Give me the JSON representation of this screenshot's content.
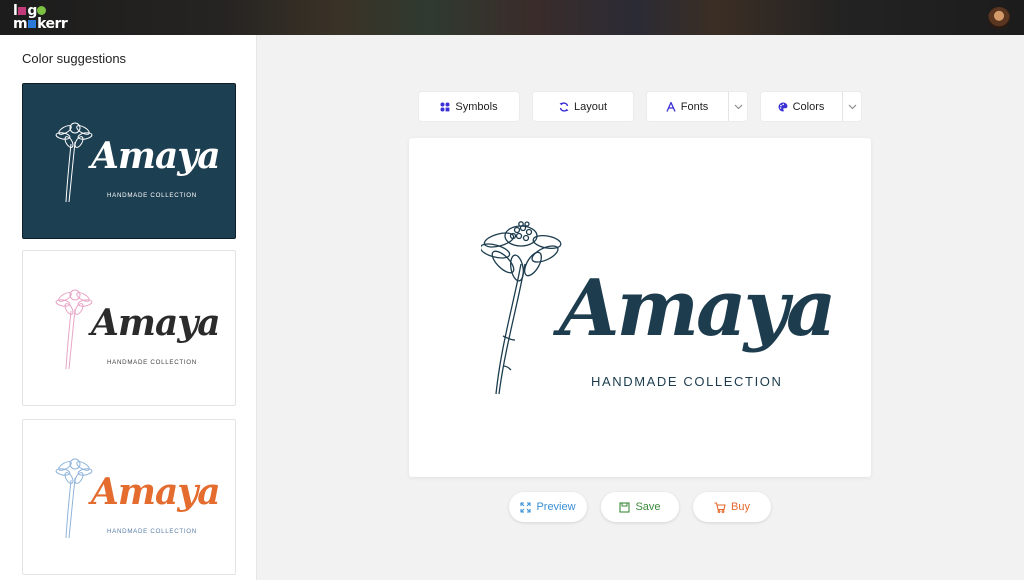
{
  "app": {
    "logo_line1": "lgo",
    "logo_line2": "mkerr",
    "logo_colors": {
      "dot": "#7cc142",
      "square": "#c23a7a"
    }
  },
  "user": {
    "avatar_icon": "user-avatar"
  },
  "sidebar": {
    "title": "Color suggestions",
    "suggestions": [
      {
        "name": "Amaya",
        "tagline": "HANDMADE COLLECTION",
        "background": "#1d3f52",
        "text_color": "#ffffff",
        "flower_color": "#ffffff",
        "tag_color": "#ffffff",
        "selected": true
      },
      {
        "name": "Amaya",
        "tagline": "HANDMADE COLLECTION",
        "background": "#ffffff",
        "text_color": "#2b2b2b",
        "flower_color": "#e8a4c6",
        "tag_color": "#444444",
        "selected": false
      },
      {
        "name": "Amaya",
        "tagline": "HANDMADE COLLECTION",
        "background": "#ffffff",
        "text_color": "#e36c2e",
        "flower_color": "#8fb3dc",
        "tag_color": "#5b7fa8",
        "selected": false
      }
    ]
  },
  "toolbar": {
    "symbols_label": "Symbols",
    "layout_label": "Layout",
    "fonts_label": "Fonts",
    "colors_label": "Colors",
    "accent": "#3b2fd6"
  },
  "canvas": {
    "name": "Amaya",
    "tagline": "HANDMADE COLLECTION",
    "color": "#1d3d4f"
  },
  "actions": {
    "preview_label": "Preview",
    "save_label": "Save",
    "buy_label": "Buy",
    "colors": {
      "preview": "#3a8fd6",
      "save": "#3b8a3b",
      "buy": "#e4692e"
    }
  }
}
